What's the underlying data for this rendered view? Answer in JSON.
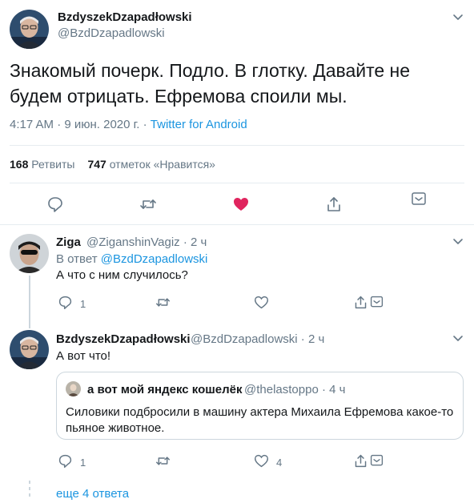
{
  "main_tweet": {
    "author_name": "BzdyszekDzapadłowski",
    "author_handle": "@BzdDzapadlowski",
    "text": "Знакомый почерк. Подло. В глотку. Давайте не будем отрицать. Ефремова споили мы.",
    "time": "4:17 AM · 9 июн. 2020 г. · ",
    "source": "Twitter for Android",
    "retweets_count": "168",
    "retweets_label": "Ретвиты",
    "likes_count": "747",
    "likes_label": "отметок «Нравится»",
    "liked": true
  },
  "replies": [
    {
      "author_name": "Ziga",
      "author_handle": "@ZiganshinVagiz",
      "time": "· 2 ч",
      "reply_to_prefix": "В ответ ",
      "reply_to_handle": "@BzdDzapadlowski",
      "text": "А что с ним случилось?",
      "reply_count": "1",
      "retweet_count": "",
      "like_count": ""
    },
    {
      "author_name": "BzdyszekDzapadłowski",
      "author_handle": "@BzdDzapadlowski",
      "time": "· 2 ч",
      "text": "А вот что!",
      "quote": {
        "author_name": "а вот мой яндекс кошелёк",
        "author_handle": "@thelastoppo",
        "time": "· 4 ч",
        "text": "Силовики подбросили в машину актера Михаила Ефремова какое-то пьяное животное."
      },
      "reply_count": "1",
      "retweet_count": "",
      "like_count": "4"
    }
  ],
  "show_more": "еще 4 ответа",
  "icons": {
    "reply": "reply-icon",
    "retweet": "retweet-icon",
    "like": "heart-icon",
    "share": "share-icon",
    "more": "chevron-down-icon"
  },
  "colors": {
    "accent": "#1b95e0",
    "like_active": "#e0245e",
    "muted": "#657786",
    "border": "#e6ecf0"
  }
}
